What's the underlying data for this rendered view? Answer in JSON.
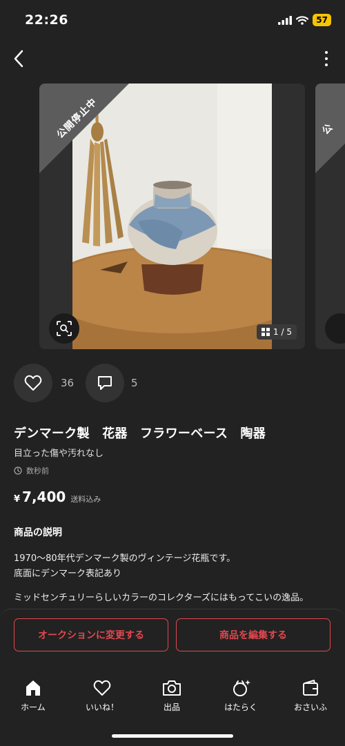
{
  "status_bar": {
    "time": "22:26",
    "battery": "57"
  },
  "carousel": {
    "ribbon": "公開停止中",
    "page_indicator": "1 / 5",
    "second_ribbon": "公"
  },
  "actions": {
    "likes": "36",
    "comments": "5"
  },
  "item": {
    "title": "デンマーク製　花器　フラワーベース　陶器",
    "condition": "目立った傷や汚れなし",
    "posted": "数秒前",
    "price_symbol": "¥",
    "price": "7,400",
    "price_note": "送料込み"
  },
  "description": {
    "heading": "商品の説明",
    "lines": [
      "1970～80年代デンマーク製のヴィンテージ花瓶です。",
      "底面にデンマーク表記あり",
      "ミッドセンチュリーらしいカラーのコレクターズにはもってこいの逸品。"
    ]
  },
  "buttons": {
    "auction": "オークションに変更する",
    "edit": "商品を編集する"
  },
  "tabs": [
    "ホーム",
    "いいね！",
    "出品",
    "はたらく",
    "おさいふ"
  ],
  "colors": {
    "background": "#222222",
    "accent": "#e0484f",
    "ribbon": "#5c5c5c"
  }
}
